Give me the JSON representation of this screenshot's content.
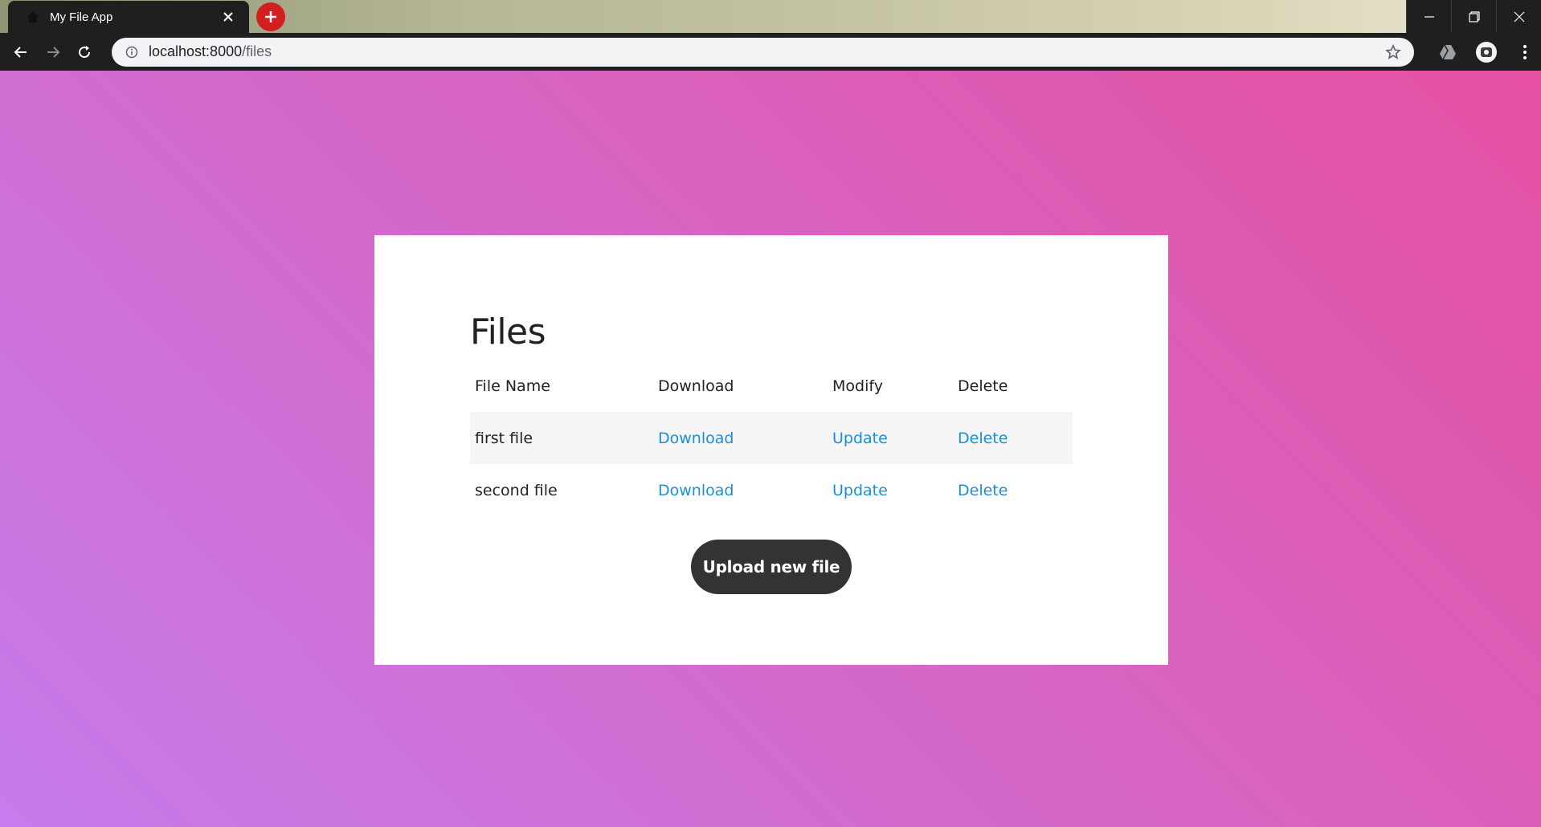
{
  "browser": {
    "tab": {
      "title": "My File App"
    },
    "address": {
      "host": "localhost:8000",
      "path": "/files"
    }
  },
  "colors": {
    "link": "#1a8fd8",
    "button_bg": "#333333",
    "gradient_start": "#c67cec",
    "gradient_end": "#e550a2",
    "new_tab_red": "#d21f1f"
  },
  "page": {
    "title": "Files",
    "table": {
      "headers": [
        "File Name",
        "Download",
        "Modify",
        "Delete"
      ],
      "rows": [
        {
          "name": "first file",
          "download": "Download",
          "modify": "Update",
          "delete": "Delete"
        },
        {
          "name": "second file",
          "download": "Download",
          "modify": "Update",
          "delete": "Delete"
        }
      ]
    },
    "upload_button": "Upload new file"
  }
}
